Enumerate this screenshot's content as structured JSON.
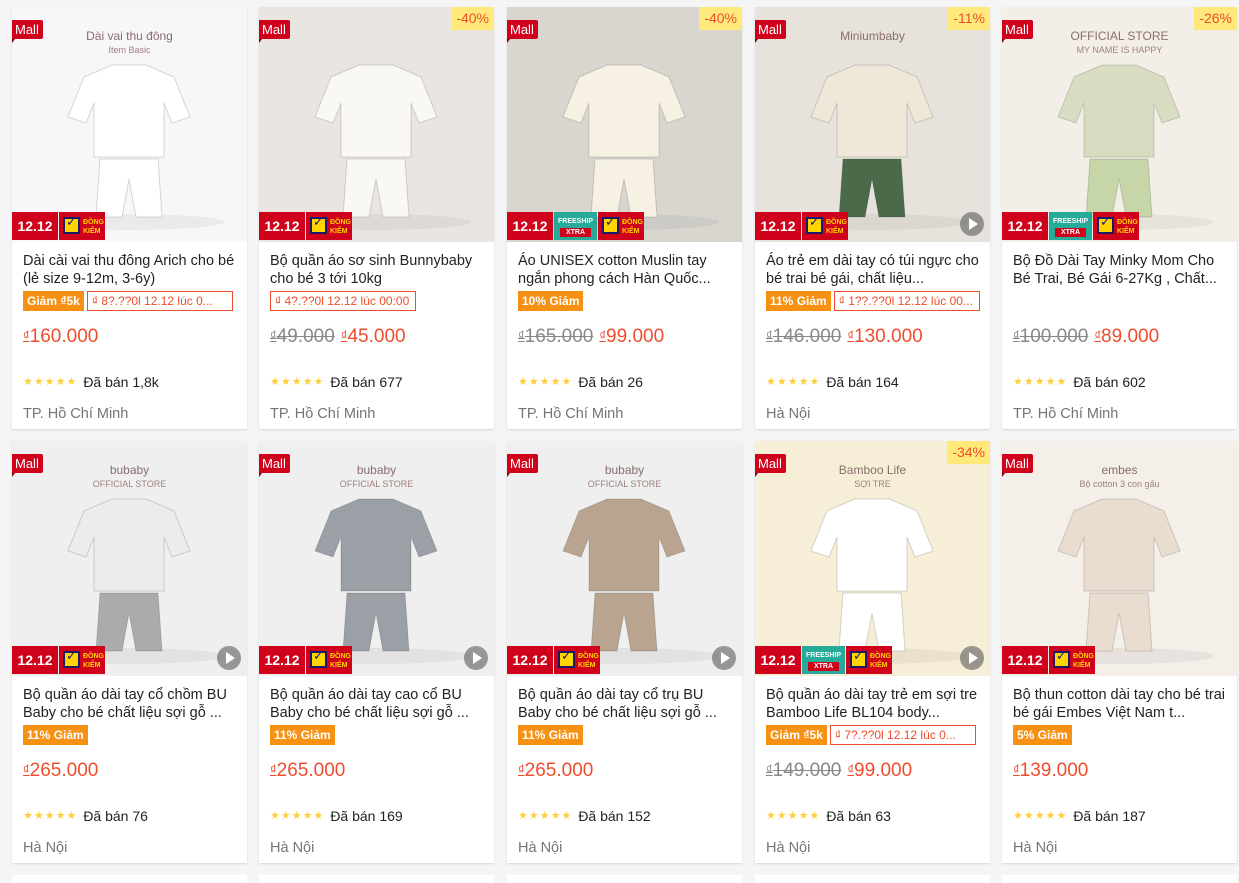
{
  "labels": {
    "mall": "Mall",
    "campaign": "12.12",
    "dongkiem_line1": "ĐỒNG",
    "dongkiem_line2": "KIỂM",
    "freeship_line1": "FREESHIP",
    "freeship_line2": "XTRA",
    "currency": "₫"
  },
  "colors": {
    "primary": "#ee4d2d",
    "mall": "#d0011b",
    "promo": "#f69113",
    "freeship": "#26aa99",
    "star": "#ffce3d"
  },
  "products": [
    {
      "name": "Dài cài vai thu đông Arich cho bé (lẻ size 9-12m, 3-6y)",
      "discount": "",
      "promo_pill": "Giảm ₫5k",
      "voucher": "₫ 8?.??0l 12.12 lúc 0...",
      "old_price": "",
      "price": "160.000",
      "stars": "★★★★★",
      "sold": "Đã bán 1,8k",
      "location": "TP. Hồ Chí Minh",
      "freeship": false,
      "video": false,
      "img_text": "Dài vai thu đông",
      "img_text2": "Item Basic"
    },
    {
      "name": "Bộ quần áo sơ sinh Bunnybaby cho bé 3 tới 10kg",
      "discount": "-40%",
      "promo_pill": "",
      "voucher": "₫ 4?.??0l 12.12 lúc 00:00",
      "old_price": "49.000",
      "price": "45.000",
      "stars": "★★★★★",
      "sold": "Đã bán 677",
      "location": "TP. Hồ Chí Minh",
      "freeship": false,
      "video": false,
      "img_text": "",
      "img_text2": ""
    },
    {
      "name": "Áo UNISEX cotton Muslin tay ngắn phong cách Hàn Quốc...",
      "discount": "-40%",
      "promo_pill": "10% Giảm",
      "voucher": "",
      "old_price": "165.000",
      "price": "99.000",
      "stars": "★★★★★",
      "sold": "Đã bán 26",
      "location": "TP. Hồ Chí Minh",
      "freeship": true,
      "video": false,
      "img_text": "",
      "img_text2": ""
    },
    {
      "name": "Áo trẻ em dài tay có túi ngực cho bé trai bé gái, chất liệu...",
      "discount": "-11%",
      "promo_pill": "11% Giảm",
      "voucher": "₫ 1??.??0l 12.12 lúc 00...",
      "old_price": "146.000",
      "price": "130.000",
      "stars": "★★★★★",
      "sold": "Đã bán 164",
      "location": "Hà Nội",
      "freeship": false,
      "video": true,
      "img_text": "Miniumbaby",
      "img_text2": ""
    },
    {
      "name": "Bộ Đồ Dài Tay Minky Mom Cho Bé Trai, Bé Gái 6-27Kg , Chất...",
      "discount": "-26%",
      "promo_pill": "",
      "voucher": "",
      "old_price": "100.000",
      "price": "89.000",
      "stars": "★★★★★",
      "sold": "Đã bán 602",
      "location": "TP. Hồ Chí Minh",
      "freeship": true,
      "video": false,
      "img_text": "OFFICIAL STORE",
      "img_text2": "MY NAME IS HAPPY"
    },
    {
      "name": "Bộ quần áo dài tay cổ chồm BU Baby cho bé chất liệu sợi gỗ ...",
      "discount": "",
      "promo_pill": "11% Giảm",
      "voucher": "",
      "old_price": "",
      "price": "265.000",
      "stars": "★★★★★",
      "sold": "Đã bán 76",
      "location": "Hà Nội",
      "freeship": false,
      "video": true,
      "img_text": "bubaby",
      "img_text2": "OFFICIAL STORE"
    },
    {
      "name": "Bộ quần áo dài tay cao cổ BU Baby cho bé chất liệu sợi gỗ ...",
      "discount": "",
      "promo_pill": "11% Giảm",
      "voucher": "",
      "old_price": "",
      "price": "265.000",
      "stars": "★★★★★",
      "sold": "Đã bán 169",
      "location": "Hà Nội",
      "freeship": false,
      "video": true,
      "img_text": "bubaby",
      "img_text2": "OFFICIAL STORE"
    },
    {
      "name": "Bộ quần áo dài tay cổ trụ BU Baby cho bé chất liệu sợi gỗ ...",
      "discount": "",
      "promo_pill": "11% Giảm",
      "voucher": "",
      "old_price": "",
      "price": "265.000",
      "stars": "★★★★★",
      "sold": "Đã bán 152",
      "location": "Hà Nội",
      "freeship": false,
      "video": true,
      "img_text": "bubaby",
      "img_text2": "OFFICIAL STORE"
    },
    {
      "name": "Bộ quần áo dài tay trẻ em sợi tre Bamboo Life BL104 body...",
      "discount": "-34%",
      "promo_pill": "Giảm ₫5k",
      "voucher": "₫ 7?.??0l 12.12 lúc 0...",
      "old_price": "149.000",
      "price": "99.000",
      "stars": "★★★★★",
      "sold": "Đã bán 63",
      "location": "Hà Nội",
      "freeship": true,
      "video": true,
      "img_text": "Bamboo Life",
      "img_text2": "SỢI TRE"
    },
    {
      "name": "Bộ thun cotton dài tay cho bé trai bé gái Embes Việt Nam t...",
      "discount": "",
      "promo_pill": "5% Giảm",
      "voucher": "",
      "old_price": "",
      "price": "139.000",
      "stars": "★★★★★",
      "sold": "Đã bán 187",
      "location": "Hà Nội",
      "freeship": false,
      "video": false,
      "img_text": "embes",
      "img_text2": "Bộ cotton 3 con gấu"
    }
  ]
}
